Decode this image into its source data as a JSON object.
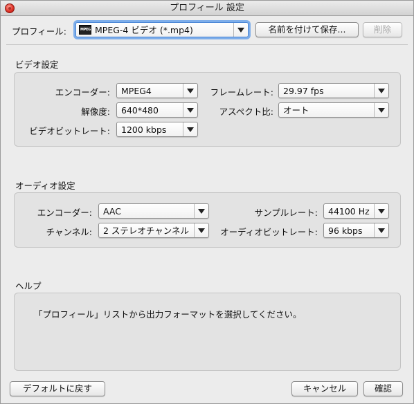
{
  "window": {
    "title": "プロフィール 設定"
  },
  "profile": {
    "label": "プロフィール:",
    "icon_text": "MPEG",
    "selected": "MPEG-4 ビデオ (*.mp4)",
    "save_as_label": "名前を付けて保存...",
    "delete_label": "削除"
  },
  "video": {
    "section_title": "ビデオ設定",
    "encoder": {
      "label": "エンコーダー:",
      "value": "MPEG4"
    },
    "resolution": {
      "label": "解像度:",
      "value": "640*480"
    },
    "bitrate": {
      "label": "ビデオビットレート:",
      "value": "1200 kbps"
    },
    "framerate": {
      "label": "フレームレート:",
      "value": "29.97 fps"
    },
    "aspect": {
      "label": "アスペクト比:",
      "value": "オート"
    }
  },
  "audio": {
    "section_title": "オーディオ設定",
    "encoder": {
      "label": "エンコーダー:",
      "value": "AAC"
    },
    "channel": {
      "label": "チャンネル:",
      "value": "2 ステレオチャンネル"
    },
    "samplerate": {
      "label": "サンプルレート:",
      "value": "44100 Hz"
    },
    "bitrate": {
      "label": "オーディオビットレート:",
      "value": "96 kbps"
    }
  },
  "help": {
    "section_title": "ヘルプ",
    "text": "「プロフィール」リストから出力フォーマットを選択してください。"
  },
  "footer": {
    "reset_label": "デフォルトに戻す",
    "cancel_label": "キャンセル",
    "ok_label": "確認"
  }
}
